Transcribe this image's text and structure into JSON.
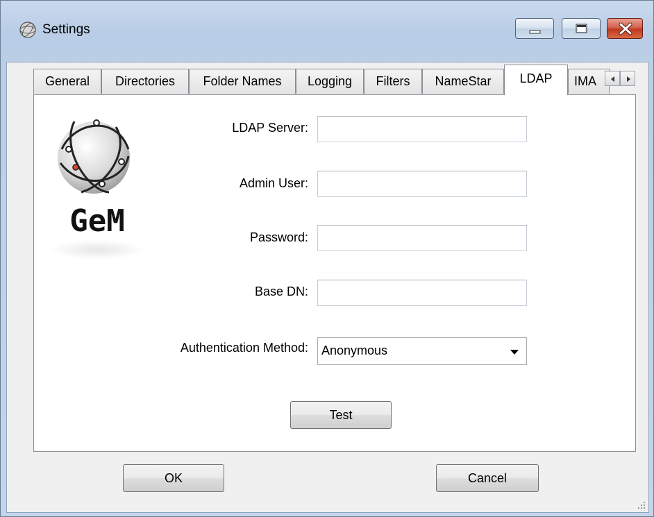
{
  "window": {
    "title": "Settings",
    "controls": [
      "minimize",
      "maximize",
      "close"
    ]
  },
  "tabs": [
    {
      "label": "General",
      "active": false
    },
    {
      "label": "Directories",
      "active": false
    },
    {
      "label": "Folder Names",
      "active": false
    },
    {
      "label": "Logging",
      "active": false
    },
    {
      "label": "Filters",
      "active": false
    },
    {
      "label": "NameStar",
      "active": false
    },
    {
      "label": "LDAP",
      "active": true
    },
    {
      "label": "IMA",
      "active": false
    }
  ],
  "logo": {
    "text": "GeM"
  },
  "form": {
    "ldap_server": {
      "label": "LDAP Server:",
      "value": ""
    },
    "admin_user": {
      "label": "Admin User:",
      "value": ""
    },
    "password": {
      "label": "Password:",
      "value": ""
    },
    "base_dn": {
      "label": "Base DN:",
      "value": ""
    },
    "auth_method": {
      "label": "Authentication Method:",
      "value": "Anonymous"
    },
    "test_label": "Test"
  },
  "footer": {
    "ok_label": "OK",
    "cancel_label": "Cancel"
  },
  "colors": {
    "frame": "#b9cde6",
    "client": "#f0f0f0",
    "close": "#c1391f"
  }
}
